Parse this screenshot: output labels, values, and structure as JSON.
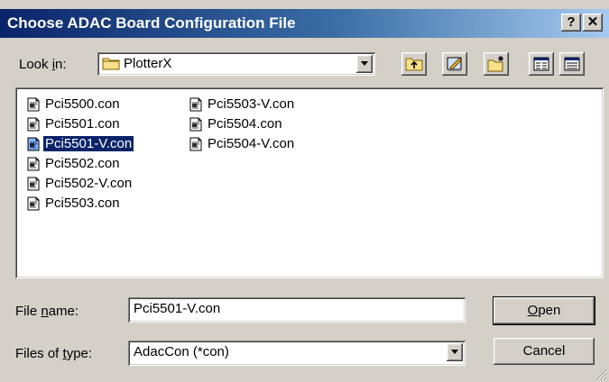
{
  "window": {
    "title": "Choose ADAC Board Configuration File",
    "help_label": "?",
    "close_label": "✕"
  },
  "look_in": {
    "label_pre": "Look ",
    "label_accel": "i",
    "label_post": "n:",
    "folder": "PlotterX"
  },
  "toolbar": {
    "icons": [
      "up-one-level-icon",
      "desktop-icon",
      "new-folder-icon",
      "list-view-icon",
      "details-view-icon"
    ]
  },
  "files": {
    "columns": [
      [
        "Pci5500.con",
        "Pci5501.con",
        "Pci5501-V.con",
        "Pci5502.con",
        "Pci5502-V.con",
        "Pci5503.con"
      ],
      [
        "Pci5503-V.con",
        "Pci5504.con",
        "Pci5504-V.con"
      ]
    ],
    "selected": "Pci5501-V.con"
  },
  "file_name": {
    "label_pre": "File ",
    "label_accel": "n",
    "label_post": "ame:",
    "value": "Pci5501-V.con"
  },
  "file_type": {
    "label_pre": "Files of ",
    "label_accel": "t",
    "label_post": "ype:",
    "value": "AdacCon (*con)"
  },
  "buttons": {
    "open_accel": "O",
    "open_rest": "pen",
    "cancel": "Cancel"
  },
  "colors": {
    "title_start": "#0a246a",
    "title_end": "#a6caf0",
    "face": "#d4d0c8",
    "selection": "#0a246a"
  }
}
